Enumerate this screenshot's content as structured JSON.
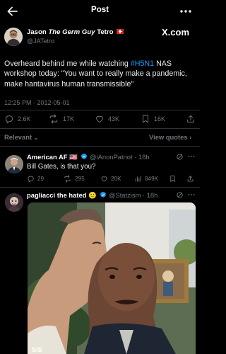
{
  "header": {
    "title": "Post"
  },
  "post": {
    "author_name": "Jason",
    "author_title": "The Germ Guy",
    "author_surname": "Tetro",
    "handle": "@JATetro",
    "text_before": "Overheard behind me while watching ",
    "hashtag": "#H5N1",
    "text_after": " NAS workshop today: \"You want to really make a pandemic, make hantavirus human transmissible\"",
    "timestamp": "12:25 PM · 2012-05-01",
    "stats": {
      "replies": "2.6K",
      "reposts": "17K",
      "likes": "43K",
      "bookmarks": "16K"
    }
  },
  "brand": {
    "logo": "X.com"
  },
  "replies_bar": {
    "sort_label": "Relevant",
    "view_quotes": "View quotes"
  },
  "replies": [
    {
      "name": "American AF",
      "flag": "🇺🇸",
      "handle": "@iAnonPatriot · 18h",
      "text": "Bill Gates, is that you?",
      "stats": {
        "replies": "29",
        "reposts": "295",
        "likes": "20K",
        "views": "849K"
      }
    },
    {
      "name": "pagliacci the hated",
      "emoji": "🙂",
      "handle": "@Statzism · 18h",
      "media_caption": "SIS"
    }
  ],
  "colors": {
    "accent": "#1d9bf0",
    "muted": "#71767b",
    "background": "#000000",
    "text": "#e7e9ea"
  }
}
